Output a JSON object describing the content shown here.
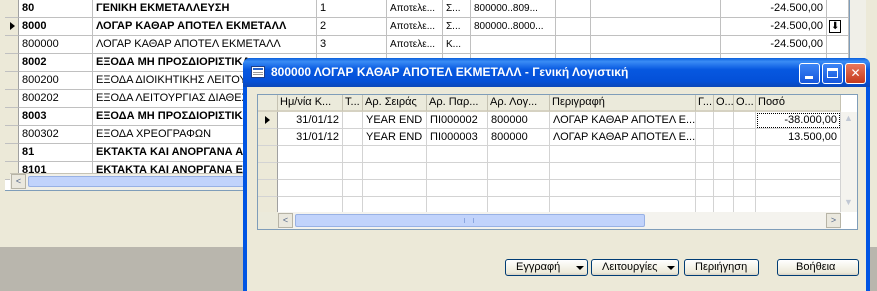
{
  "background": {
    "rows": [
      {
        "code": "80",
        "name": "ΓΕΝΙΚΗ ΕΚΜΕΤΑΛΛΕΥΣΗ",
        "level": "1",
        "c4": "Αποτελε...",
        "c5": "Σ...",
        "range": "800000..809...",
        "amount": "-24.500,00",
        "bold": true,
        "selected": false,
        "extra": ""
      },
      {
        "code": "8000",
        "name": "ΛΟΓΑΡ ΚΑΘΑΡ ΑΠΟΤΕΛ ΕΚΜΕΤΑΛΛ",
        "level": "2",
        "c4": "Αποτελε...",
        "c5": "Σ...",
        "range": "800000..8000...",
        "amount": "-24.500,00",
        "bold": true,
        "selected": true,
        "extra": "⬇"
      },
      {
        "code": "800000",
        "name": "ΛΟΓΑΡ ΚΑΘΑΡ ΑΠΟΤΕΛ ΕΚΜΕΤΑΛΛ",
        "level": "3",
        "c4": "Αποτελε...",
        "c5": "Κ...",
        "range": "",
        "amount": "-24.500,00",
        "bold": false,
        "selected": false,
        "extra": ""
      },
      {
        "code": "8002",
        "name": "ΕΞΟΔΑ ΜΗ ΠΡΟΣΔΙΟΡΙΣΤΙΚΑ",
        "level": "",
        "c4": "",
        "c5": "",
        "range": "",
        "amount": "",
        "bold": true,
        "selected": false,
        "extra": ""
      },
      {
        "code": "800200",
        "name": "ΕΞΟΔΑ ΔΙΟΙΚΗΤΙΚΗΣ ΛΕΙΤΟΥΡ",
        "level": "",
        "c4": "",
        "c5": "",
        "range": "",
        "amount": "",
        "bold": false,
        "selected": false,
        "extra": ""
      },
      {
        "code": "800202",
        "name": "ΕΞΟΔΑ ΛΕΙΤΟΥΡΓΙΑΣ ΔΙΑΘΕΣΕ",
        "level": "",
        "c4": "",
        "c5": "",
        "range": "",
        "amount": "",
        "bold": false,
        "selected": false,
        "extra": ""
      },
      {
        "code": "8003",
        "name": "ΕΞΟΔΑ ΜΗ ΠΡΟΣΔΙΟΡΙΣΤΙΚΑ",
        "level": "",
        "c4": "",
        "c5": "",
        "range": "",
        "amount": "",
        "bold": true,
        "selected": false,
        "extra": ""
      },
      {
        "code": "800302",
        "name": "ΕΞΟΔΑ ΧΡΕΟΓΡΑΦΩΝ",
        "level": "",
        "c4": "",
        "c5": "",
        "range": "",
        "amount": "",
        "bold": false,
        "selected": false,
        "extra": ""
      },
      {
        "code": "81",
        "name": "ΕΚΤΑΚΤΑ ΚΑΙ ΑΝΟΡΓΑΝΑ ΑΠΟΤ",
        "level": "",
        "c4": "",
        "c5": "",
        "range": "",
        "amount": "",
        "bold": true,
        "selected": false,
        "extra": ""
      },
      {
        "code": "8101",
        "name": "ΕΚΤΑΚΤΑ ΚΑΙ ΑΝΟΡΓΑΝΑ ΕΣ",
        "level": "",
        "c4": "",
        "c5": "",
        "range": "",
        "amount": "",
        "bold": true,
        "selected": false,
        "extra": ""
      }
    ],
    "scroll_left": "<"
  },
  "dialog": {
    "title": "800000 ΛΟΓΑΡ ΚΑΘΑΡ ΑΠΟΤΕΛ ΕΚΜΕΤΑΛΛ - Γενική Λογιστική",
    "close_glyph": "✕",
    "columns": [
      "Ημ/νία Κ...",
      "Τ...",
      "Αρ. Σειράς",
      "Αρ. Παρ...",
      "Αρ. Λογ...",
      "Περιγραφή",
      "Γ...",
      "Ο...",
      "Ο...",
      "Ποσό"
    ],
    "rows": [
      {
        "date": "31/01/12",
        "t": "",
        "series": "YEAR END",
        "doc": "ΠΙ000002",
        "account": "800000",
        "description": "ΛΟΓΑΡ ΚΑΘΑΡ ΑΠΟΤΕΛ Ε...",
        "g": "",
        "o1": "",
        "o2": "",
        "amount": "-38.000,00",
        "current": true
      },
      {
        "date": "31/01/12",
        "t": "",
        "series": "YEAR END",
        "doc": "ΠΙ000003",
        "account": "800000",
        "description": "ΛΟΓΑΡ ΚΑΘΑΡ ΑΠΟΤΕΛ Ε...",
        "g": "",
        "o1": "",
        "o2": "",
        "amount": "13.500,00",
        "current": false
      }
    ],
    "scroll": {
      "up": "▲",
      "down": "▼",
      "left": "<",
      "right": ">"
    },
    "buttons": [
      {
        "label": "Εγγραφή",
        "dropdown": true
      },
      {
        "label": "Λειτουργίες",
        "dropdown": true
      },
      {
        "label": "Περιήγηση",
        "dropdown": false
      },
      {
        "label": "Βοήθεια",
        "dropdown": false
      }
    ]
  }
}
